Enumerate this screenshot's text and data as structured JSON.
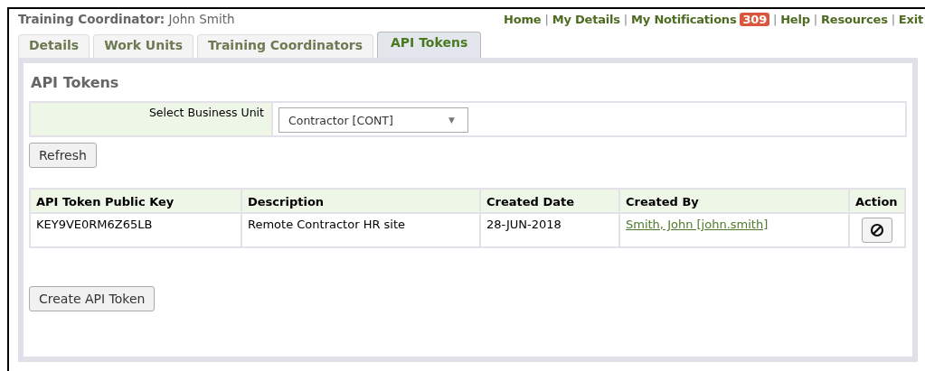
{
  "header": {
    "role_label": "Training Coordinator:",
    "user_name": "John Smith"
  },
  "nav": [
    {
      "kind": "link",
      "text": "Home"
    },
    {
      "kind": "separator",
      "text": "|"
    },
    {
      "kind": "link",
      "text": "My Details"
    },
    {
      "kind": "separator",
      "text": "|"
    },
    {
      "kind": "link",
      "text": "My Notifications"
    },
    {
      "kind": "badge",
      "text": "309"
    },
    {
      "kind": "separator",
      "text": "|"
    },
    {
      "kind": "link",
      "text": "Help"
    },
    {
      "kind": "separator",
      "text": "|"
    },
    {
      "kind": "link",
      "text": "Resources"
    },
    {
      "kind": "separator",
      "text": "|"
    },
    {
      "kind": "link",
      "text": "Exit"
    }
  ],
  "tabs": [
    {
      "label": "Details",
      "selected": false
    },
    {
      "label": "Work Units",
      "selected": false
    },
    {
      "label": "Training Coordinators",
      "selected": false
    },
    {
      "label": "API Tokens",
      "selected": true
    }
  ],
  "panel": {
    "title": "API Tokens",
    "business_unit": {
      "label": "Select Business Unit",
      "value": "Contractor [CONT]",
      "caret": "▼"
    },
    "refresh_button": "Refresh",
    "table": {
      "columns": [
        "API Token Public Key",
        "Description",
        "Created Date",
        "Created By",
        "Action"
      ],
      "rows": [
        {
          "key": "KEY9VE0RM6Z65LB",
          "description": "Remote Contractor HR site",
          "created_date": "28-JUN-2018",
          "created_by": "Smith, John [john.smith]"
        }
      ]
    },
    "create_button": "Create API Token"
  }
}
